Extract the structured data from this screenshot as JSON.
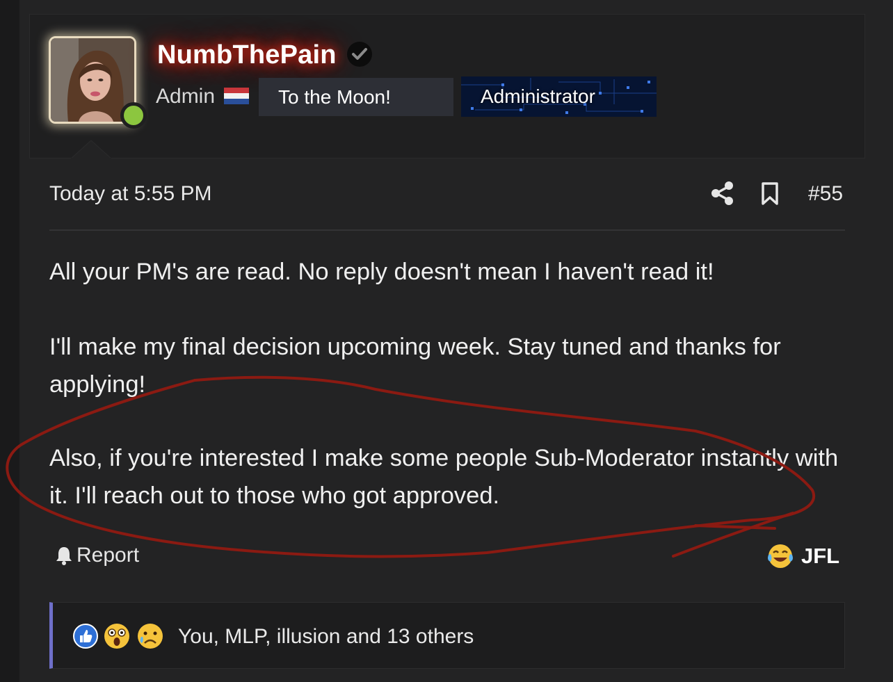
{
  "user": {
    "username": "NumbThePain",
    "role": "Admin",
    "banners": [
      "To the Moon!",
      "Administrator"
    ],
    "online": true
  },
  "post": {
    "date": "Today at 5:55 PM",
    "number": "#55",
    "paragraphs": [
      "All your PM's are read. No reply doesn't mean I haven't read it!",
      "I'll make my final decision upcoming week. Stay tuned and thanks for applying!",
      "Also, if you're interested I make some people Sub-Moderator instantly with it. I'll reach out to those who got approved."
    ]
  },
  "actions": {
    "report_label": "Report",
    "my_reaction_label": "JFL"
  },
  "reactions": {
    "summary": "You, MLP, illusion and 13 others",
    "icons": [
      "like-icon",
      "shocked-face-icon",
      "sad-face-icon"
    ]
  },
  "colors": {
    "page_bg": "#232324",
    "username_glow": "#d62a1a",
    "online": "#8cc63f",
    "reactions_accent": "#6e6fc9",
    "annotation_stroke": "#8b1a12"
  }
}
